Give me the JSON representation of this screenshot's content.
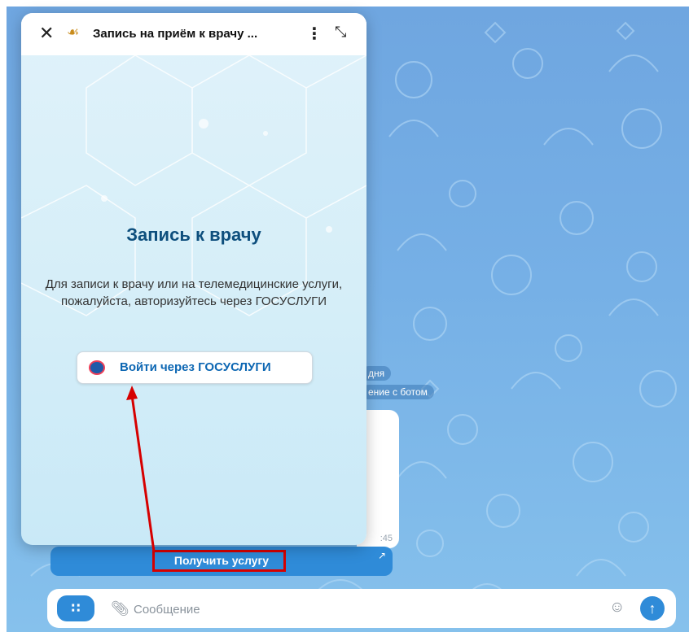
{
  "miniapp": {
    "title": "Запись на приём к врачу ...",
    "close_icon": "close-icon",
    "emblem_icon": "coat-of-arms-icon",
    "more_icon": "more-vertical-icon",
    "expand_icon": "expand-icon",
    "page_title": "Запись к врачу",
    "description": "Для записи к врачу или на телемедицинские услуги, пожалуйста, авторизуйтесь через ГОСУСЛУГИ",
    "login_button_label": "Войти через ГОСУСЛУГИ",
    "login_icon": "gosuslugi-logo-icon"
  },
  "chat": {
    "date_pill": "дня",
    "info_pill": "ение с ботом",
    "message_time": ":45",
    "inline_button_label": "Получить услугу",
    "inline_button_icon": "external-link-icon"
  },
  "composer": {
    "menu_icon": "bot-menu-icon",
    "attach_icon": "paperclip-icon",
    "placeholder": "Сообщение",
    "sticker_icon": "sticker-icon",
    "send_icon": "send-arrow-icon"
  },
  "colors": {
    "accent": "#2f8bd8",
    "annotation_red": "#d60000",
    "title_blue": "#0e4f7d"
  }
}
